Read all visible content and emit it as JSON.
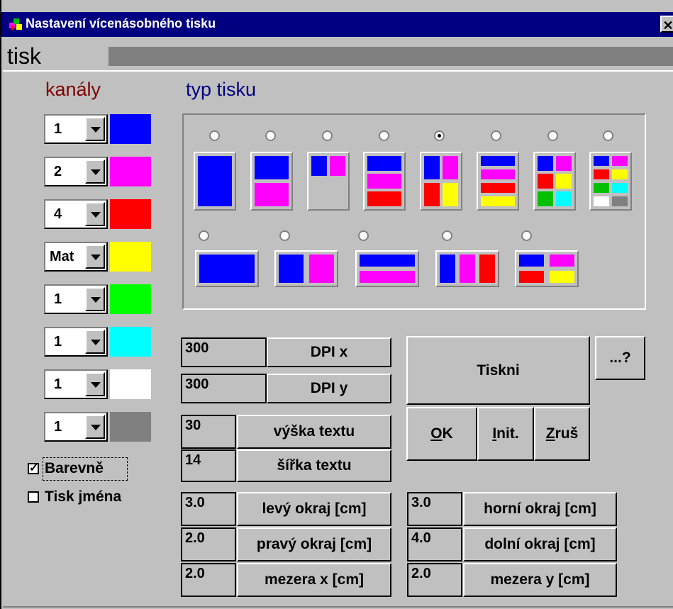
{
  "window": {
    "title": "Nastavení  vícenásobného  tisku",
    "close_symbol": "✕"
  },
  "tab": {
    "label": "tisk"
  },
  "channels": {
    "heading": "kanály",
    "items": [
      {
        "value": "1",
        "color": "#0000ff"
      },
      {
        "value": "2",
        "color": "#ff00ff"
      },
      {
        "value": "4",
        "color": "#ff0000"
      },
      {
        "value": "Mat",
        "color": "#ffff00"
      },
      {
        "value": "1",
        "color": "#00ff00"
      },
      {
        "value": "1",
        "color": "#00ffff"
      },
      {
        "value": "1",
        "color": "#ffffff"
      },
      {
        "value": "1",
        "color": "#808080"
      }
    ]
  },
  "options": {
    "color_label": "Barevně",
    "color_checked": true,
    "name_label": "Tisk jména",
    "name_checked": false
  },
  "print_type": {
    "heading": "typ tisku",
    "selected_index": 4
  },
  "dpi": {
    "x_value": "300",
    "x_label": "DPI x",
    "y_value": "300",
    "y_label": "DPI y"
  },
  "text_size": {
    "height_value": "30",
    "height_label": "výška textu",
    "width_value": "14",
    "width_label": "šířka textu"
  },
  "margins": {
    "left_value": "3.0",
    "left_label": "levý okraj [cm]",
    "right_value": "2.0",
    "right_label": "pravý okraj [cm]",
    "gapx_value": "2.0",
    "gapx_label": "mezera x [cm]",
    "top_value": "3.0",
    "top_label": "horní okraj [cm]",
    "bottom_value": "4.0",
    "bottom_label": "dolní okraj [cm]",
    "gapy_value": "2.0",
    "gapy_label": "mezera y [cm]"
  },
  "actions": {
    "print_label": "Tiskni",
    "help_label": "...?",
    "ok_mnemonic": "O",
    "ok_rest": "K",
    "init_mnemonic": "I",
    "init_rest": "nit.",
    "cancel_mnemonic": "Z",
    "cancel_rest": "ruš"
  }
}
